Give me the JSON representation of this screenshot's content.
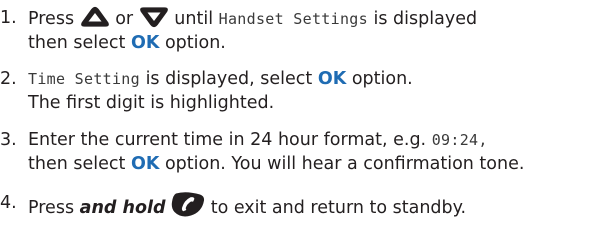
{
  "steps": [
    {
      "number": "1.",
      "press": "Press",
      "up_icon": "up-arrow-key-icon",
      "or": "or",
      "down_icon": "down-arrow-key-icon",
      "until": "until",
      "screen_text": "Handset Settings",
      "is_displayed": "is displayed",
      "then_select": "then select",
      "ok": "OK",
      "option": "option."
    },
    {
      "number": "2.",
      "screen_text": "Time Setting",
      "is_displayed_select": "is displayed, select",
      "ok": "OK",
      "option": "option.",
      "line2": "The first digit is highlighted."
    },
    {
      "number": "3.",
      "line1_text": "Enter the current time in 24 hour format, e.g.",
      "example": "09:24,",
      "then_select": "then select",
      "ok": "OK",
      "rest": "option. You will hear a confirmation tone."
    },
    {
      "number": "4.",
      "press": "Press",
      "and_hold": "and hold",
      "end_icon": "end-call-handset-icon",
      "rest": "to exit and return to standby."
    }
  ],
  "colors": {
    "text": "#231f20",
    "ok": "#1f6cb3",
    "lcd": "#3a3a3a"
  }
}
